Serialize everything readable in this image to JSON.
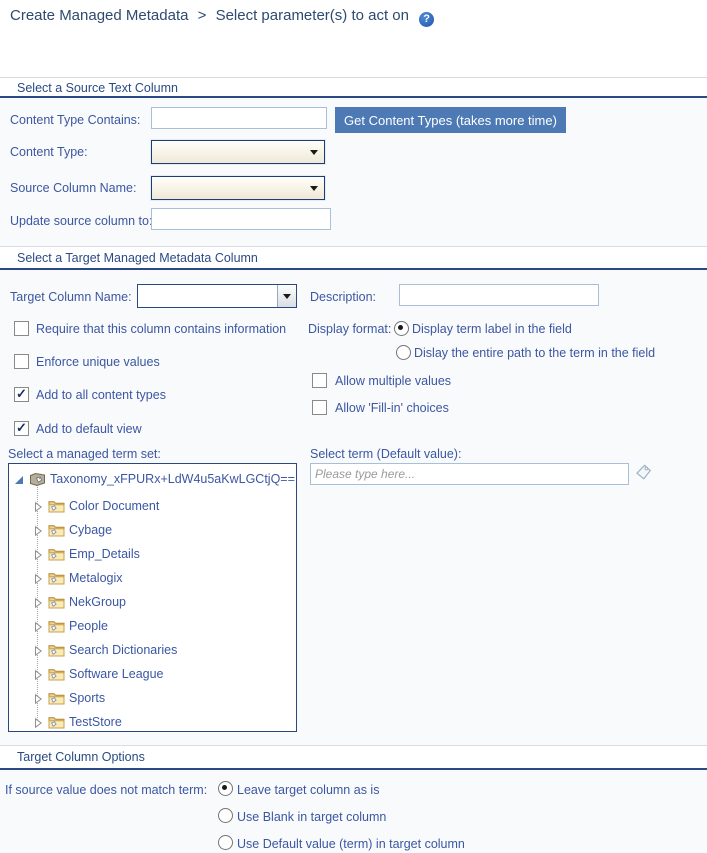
{
  "breadcrumb": {
    "primary": "Create Managed Metadata",
    "separator": ">",
    "secondary": "Select parameter(s) to act on",
    "help_glyph": "?"
  },
  "source": {
    "title": "Select a Source Text Column",
    "content_type_contains": {
      "label": "Content Type Contains:",
      "value": ""
    },
    "get_content_types_button": "Get Content Types (takes more time)",
    "content_type": {
      "label": "Content Type:",
      "value": ""
    },
    "source_column_name": {
      "label": "Source Column Name:",
      "value": ""
    },
    "update_source_column": {
      "label": "Update source column to:",
      "value": ""
    }
  },
  "target": {
    "title": "Select a Target Managed Metadata Column",
    "target_column_name": {
      "label": "Target Column Name:",
      "value": ""
    },
    "description": {
      "label": "Description:",
      "value": ""
    },
    "display_format_label": "Display format:",
    "display_options": [
      {
        "label": "Display term label in the field",
        "selected": true
      },
      {
        "label": "Dislay the entire path to the term in the field",
        "selected": false
      }
    ],
    "checkboxes_left": [
      {
        "label": "Require that this column contains information",
        "checked": false
      },
      {
        "label": "Enforce unique values",
        "checked": false
      },
      {
        "label": "Add to all content types",
        "checked": true
      },
      {
        "label": "Add to default view",
        "checked": true
      }
    ],
    "checkboxes_right": [
      {
        "label": "Allow multiple values",
        "checked": false
      },
      {
        "label": "Allow 'Fill-in' choices",
        "checked": false
      }
    ],
    "term_set_label": "Select a managed term set:",
    "select_term_label": "Select term (Default value):",
    "select_term_placeholder": "Please type here...",
    "term_tree": {
      "root": "Taxonomy_xFPURx+LdW4u5aKwLGCtjQ==",
      "items": [
        "Color Document",
        "Cybage",
        "Emp_Details",
        "Metalogix",
        "NekGroup",
        "People",
        "Search Dictionaries",
        "Software League",
        "Sports",
        "TestStore"
      ]
    }
  },
  "options": {
    "title": "Target Column Options",
    "prompt": "If source value does not match term:",
    "choices": [
      {
        "label": "Leave target column as is",
        "selected": true
      },
      {
        "label": "Use Blank in target column",
        "selected": false
      },
      {
        "label": "Use Default value (term) in target column",
        "selected": false
      }
    ]
  },
  "colors": {
    "accent_button": "#4d79b5",
    "section_rule": "#2b4a85",
    "label_text": "#3b57a3"
  }
}
